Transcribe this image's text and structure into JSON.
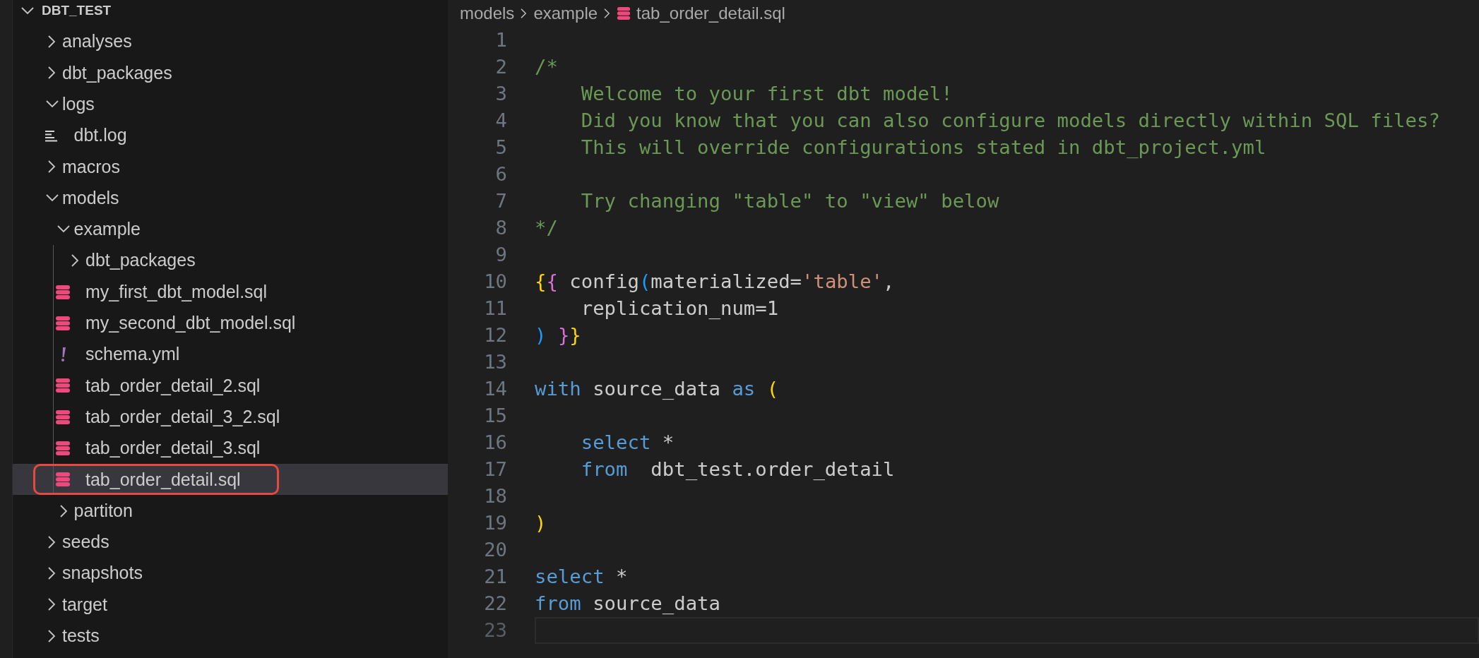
{
  "explorer": {
    "label": "DBT_TEST",
    "expanded": true,
    "children": [
      {
        "label": "analyses",
        "kind": "folder",
        "expanded": false,
        "selected": false,
        "highlighted": false
      },
      {
        "label": "dbt_packages",
        "kind": "folder",
        "expanded": false,
        "selected": false,
        "highlighted": false
      },
      {
        "label": "logs",
        "kind": "folder",
        "expanded": true,
        "selected": false,
        "highlighted": false,
        "children": [
          {
            "label": "dbt.log",
            "kind": "log",
            "selected": false,
            "highlighted": false
          }
        ]
      },
      {
        "label": "macros",
        "kind": "folder",
        "expanded": false,
        "selected": false,
        "highlighted": false
      },
      {
        "label": "models",
        "kind": "folder",
        "expanded": true,
        "selected": false,
        "highlighted": false,
        "children": [
          {
            "label": "example",
            "kind": "folder",
            "expanded": true,
            "selected": false,
            "highlighted": false,
            "children": [
              {
                "label": "dbt_packages",
                "kind": "folder",
                "expanded": false,
                "selected": false,
                "highlighted": false
              },
              {
                "label": "my_first_dbt_model.sql",
                "kind": "sql",
                "selected": false,
                "highlighted": false
              },
              {
                "label": "my_second_dbt_model.sql",
                "kind": "sql",
                "selected": false,
                "highlighted": false
              },
              {
                "label": "schema.yml",
                "kind": "yaml",
                "selected": false,
                "highlighted": false
              },
              {
                "label": "tab_order_detail_2.sql",
                "kind": "sql",
                "selected": false,
                "highlighted": false
              },
              {
                "label": "tab_order_detail_3_2.sql",
                "kind": "sql",
                "selected": false,
                "highlighted": false
              },
              {
                "label": "tab_order_detail_3.sql",
                "kind": "sql",
                "selected": false,
                "highlighted": false
              },
              {
                "label": "tab_order_detail.sql",
                "kind": "sql",
                "selected": true,
                "highlighted": true
              }
            ]
          },
          {
            "label": "partiton",
            "kind": "folder",
            "expanded": false,
            "selected": false,
            "highlighted": false
          }
        ]
      },
      {
        "label": "seeds",
        "kind": "folder",
        "expanded": false,
        "selected": false,
        "highlighted": false
      },
      {
        "label": "snapshots",
        "kind": "folder",
        "expanded": false,
        "selected": false,
        "highlighted": false
      },
      {
        "label": "target",
        "kind": "folder",
        "expanded": false,
        "selected": false,
        "highlighted": false
      },
      {
        "label": "tests",
        "kind": "folder",
        "expanded": false,
        "selected": false,
        "highlighted": false
      }
    ]
  },
  "breadcrumb": [
    {
      "label": "models",
      "kind": "folder"
    },
    {
      "label": "example",
      "kind": "folder"
    },
    {
      "label": "tab_order_detail.sql",
      "kind": "sql"
    }
  ],
  "editor": {
    "lines": [
      {
        "number": "1",
        "current": false
      },
      {
        "number": "2",
        "current": false,
        "tokens": [
          {
            "kind": "comment",
            "text": "/*"
          }
        ]
      },
      {
        "number": "3",
        "current": false,
        "tokens": [
          {
            "kind": "comment",
            "text": "    Welcome to your first dbt model!"
          }
        ]
      },
      {
        "number": "4",
        "current": false,
        "tokens": [
          {
            "kind": "comment",
            "text": "    Did you know that you can also configure models directly within SQL files?"
          }
        ]
      },
      {
        "number": "5",
        "current": false,
        "tokens": [
          {
            "kind": "comment",
            "text": "    This will override configurations stated in dbt_project.yml"
          }
        ]
      },
      {
        "number": "6",
        "current": false
      },
      {
        "number": "7",
        "current": false,
        "tokens": [
          {
            "kind": "comment",
            "text": "    Try changing \"table\" to \"view\" below"
          }
        ]
      },
      {
        "number": "8",
        "current": false,
        "tokens": [
          {
            "kind": "comment",
            "text": "*/"
          }
        ]
      },
      {
        "number": "9",
        "current": false
      },
      {
        "number": "10",
        "current": false,
        "tokens": [
          {
            "kind": "bracket1",
            "text": "{"
          },
          {
            "kind": "bracket2",
            "text": "{"
          },
          {
            "kind": "plain",
            "text": " config"
          },
          {
            "kind": "bracket3",
            "text": "("
          },
          {
            "kind": "plain",
            "text": "materialized="
          },
          {
            "kind": "string",
            "text": "'table'"
          },
          {
            "kind": "plain",
            "text": ","
          }
        ]
      },
      {
        "number": "11",
        "current": false,
        "tokens": [
          {
            "kind": "plain",
            "text": "    replication_num=1"
          }
        ]
      },
      {
        "number": "12",
        "current": false,
        "tokens": [
          {
            "kind": "bracket3",
            "text": ") "
          },
          {
            "kind": "bracket2",
            "text": "}"
          },
          {
            "kind": "bracket1",
            "text": "}"
          }
        ]
      },
      {
        "number": "13",
        "current": false
      },
      {
        "number": "14",
        "current": false,
        "tokens": [
          {
            "kind": "keyword",
            "text": "with"
          },
          {
            "kind": "plain",
            "text": " source_data "
          },
          {
            "kind": "keyword",
            "text": "as"
          },
          {
            "kind": "bracket1",
            "text": " ("
          }
        ]
      },
      {
        "number": "15",
        "current": false
      },
      {
        "number": "16",
        "current": false,
        "tokens": [
          {
            "kind": "keyword",
            "text": "    select"
          },
          {
            "kind": "plain",
            "text": " *"
          }
        ]
      },
      {
        "number": "17",
        "current": false,
        "tokens": [
          {
            "kind": "keyword",
            "text": "    from"
          },
          {
            "kind": "plain",
            "text": "  dbt_test.order_detail"
          }
        ]
      },
      {
        "number": "18",
        "current": false
      },
      {
        "number": "19",
        "current": false,
        "tokens": [
          {
            "kind": "bracket1",
            "text": ")"
          }
        ]
      },
      {
        "number": "20",
        "current": false
      },
      {
        "number": "21",
        "current": false,
        "tokens": [
          {
            "kind": "keyword",
            "text": "select"
          },
          {
            "kind": "plain",
            "text": " *"
          }
        ]
      },
      {
        "number": "22",
        "current": false,
        "tokens": [
          {
            "kind": "keyword",
            "text": "from"
          },
          {
            "kind": "plain",
            "text": " source_data"
          }
        ]
      },
      {
        "number": "23",
        "current": true
      }
    ]
  }
}
